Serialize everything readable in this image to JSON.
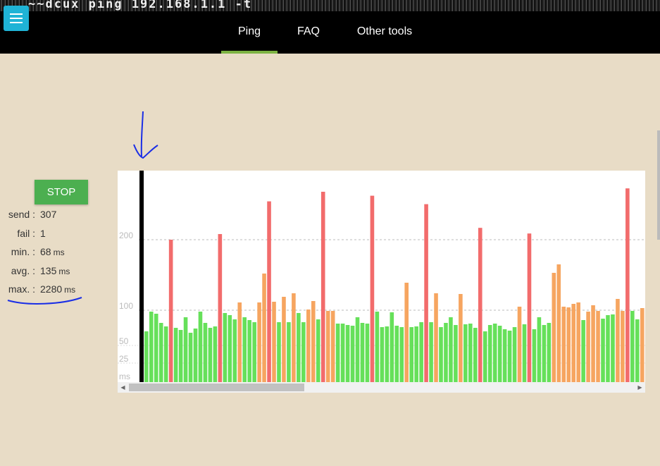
{
  "header": {
    "terminal_text": "~~dcux  ping 192.168.1.1 -t",
    "menu_icon": "hamburger-icon",
    "tabs": [
      {
        "label": "Ping",
        "active": true
      },
      {
        "label": "FAQ",
        "active": false
      },
      {
        "label": "Other tools",
        "active": false
      }
    ],
    "active_tab_color": "#7cb342"
  },
  "controls": {
    "stop_label": "STOP"
  },
  "stats": [
    {
      "label": "send",
      "value": "307",
      "unit": ""
    },
    {
      "label": "fail",
      "value": "1",
      "unit": ""
    },
    {
      "label": "min.",
      "value": "68",
      "unit": "ms"
    },
    {
      "label": "avg.",
      "value": "135",
      "unit": "ms"
    },
    {
      "label": "max.",
      "value": "2280",
      "unit": "ms"
    }
  ],
  "chart_data": {
    "type": "bar",
    "y_tick_labels": [
      "200",
      "100",
      "50",
      "25",
      "ms"
    ],
    "y_ticks": [
      200,
      100,
      50,
      25
    ],
    "y_scale": "piecewise",
    "grid": "dashed horizontal",
    "colors": {
      "green": "#66e05a",
      "orange": "#f6a560",
      "red": "#f26c6c",
      "marker": "#000000"
    },
    "marker_index": 0,
    "values": [
      70,
      98,
      95,
      82,
      77,
      200,
      75,
      72,
      90,
      68,
      74,
      98,
      82,
      75,
      77,
      210,
      96,
      93,
      87,
      111,
      90,
      86,
      83,
      111,
      152,
      268,
      112,
      83,
      119,
      83,
      124,
      96,
      83,
      101,
      113,
      87,
      285,
      99,
      99,
      81,
      81,
      79,
      78,
      90,
      82,
      81,
      278,
      98,
      76,
      77,
      97,
      78,
      76,
      139,
      76,
      77,
      83,
      263,
      83,
      124,
      76,
      82,
      90,
      79,
      123,
      80,
      81,
      75,
      221,
      70,
      79,
      81,
      78,
      73,
      71,
      76,
      105,
      80,
      211,
      73,
      90,
      79,
      82,
      153,
      165,
      105,
      104,
      109,
      111,
      86,
      98,
      107,
      99,
      88,
      93,
      94,
      116,
      99,
      291,
      99,
      87,
      103,
      103,
      96,
      97
    ],
    "colors_per_bar": [
      "g",
      "g",
      "g",
      "g",
      "g",
      "r",
      "g",
      "g",
      "g",
      "g",
      "g",
      "g",
      "g",
      "g",
      "g",
      "r",
      "g",
      "g",
      "g",
      "o",
      "g",
      "g",
      "g",
      "o",
      "o",
      "r",
      "o",
      "g",
      "o",
      "g",
      "o",
      "g",
      "g",
      "o",
      "o",
      "g",
      "r",
      "o",
      "o",
      "g",
      "g",
      "g",
      "g",
      "g",
      "g",
      "g",
      "r",
      "g",
      "g",
      "g",
      "g",
      "g",
      "g",
      "o",
      "g",
      "g",
      "g",
      "r",
      "g",
      "o",
      "g",
      "g",
      "g",
      "g",
      "o",
      "g",
      "g",
      "g",
      "r",
      "g",
      "g",
      "g",
      "g",
      "g",
      "g",
      "g",
      "o",
      "g",
      "r",
      "g",
      "g",
      "g",
      "g",
      "o",
      "o",
      "o",
      "o",
      "o",
      "o",
      "g",
      "o",
      "o",
      "o",
      "g",
      "g",
      "g",
      "o",
      "o",
      "r",
      "g",
      "g",
      "o",
      "o",
      "g",
      "g"
    ]
  }
}
